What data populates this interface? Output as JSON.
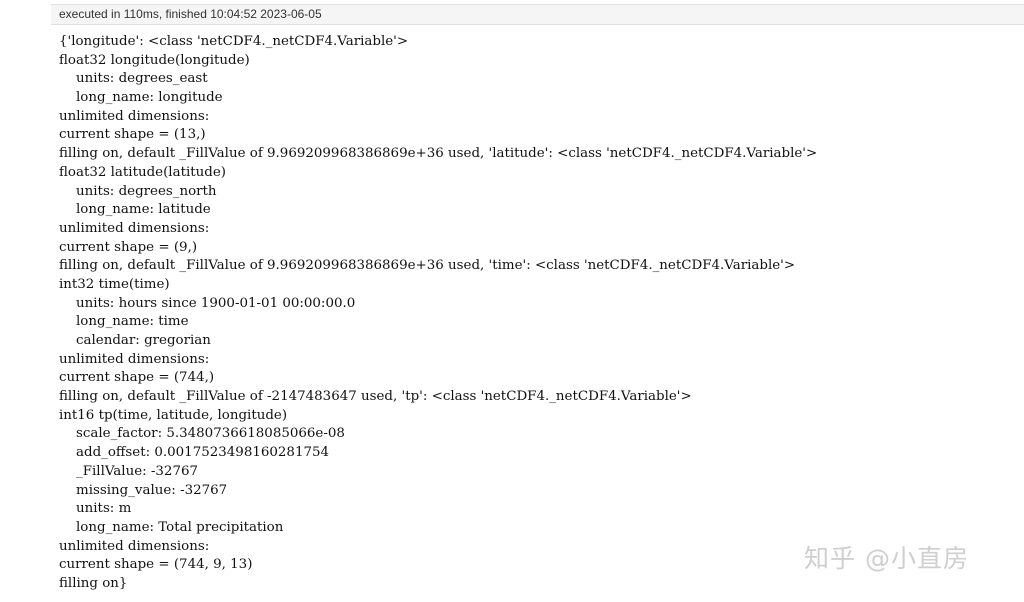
{
  "exec_status": "executed in 110ms, finished 10:04:52 2023-06-05",
  "output_lines": [
    "{'longitude': <class 'netCDF4._netCDF4.Variable'>",
    "float32 longitude(longitude)",
    "    units: degrees_east",
    "    long_name: longitude",
    "unlimited dimensions: ",
    "current shape = (13,)",
    "filling on, default _FillValue of 9.969209968386869e+36 used, 'latitude': <class 'netCDF4._netCDF4.Variable'>",
    "float32 latitude(latitude)",
    "    units: degrees_north",
    "    long_name: latitude",
    "unlimited dimensions: ",
    "current shape = (9,)",
    "filling on, default _FillValue of 9.969209968386869e+36 used, 'time': <class 'netCDF4._netCDF4.Variable'>",
    "int32 time(time)",
    "    units: hours since 1900-01-01 00:00:00.0",
    "    long_name: time",
    "    calendar: gregorian",
    "unlimited dimensions: ",
    "current shape = (744,)",
    "filling on, default _FillValue of -2147483647 used, 'tp': <class 'netCDF4._netCDF4.Variable'>",
    "int16 tp(time, latitude, longitude)",
    "    scale_factor: 5.3480736618085066e-08",
    "    add_offset: 0.0017523498160281754",
    "    _FillValue: -32767",
    "    missing_value: -32767",
    "    units: m",
    "    long_name: Total precipitation",
    "unlimited dimensions: ",
    "current shape = (744, 9, 13)",
    "filling on}"
  ],
  "watermark": "知乎 @小直房"
}
